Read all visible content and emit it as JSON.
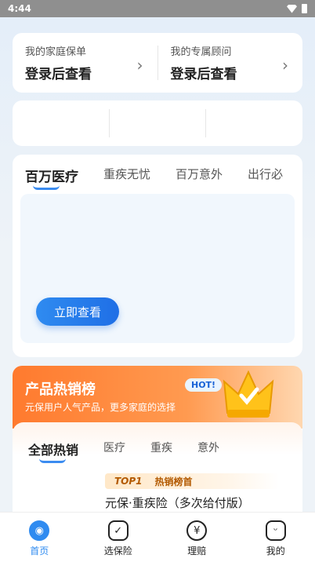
{
  "status_bar": {
    "time": "4:44"
  },
  "policy_card": {
    "left": {
      "label": "我的家庭保单",
      "value": "登录后查看"
    },
    "right": {
      "label": "我的专属顾问",
      "value": "登录后查看"
    }
  },
  "product_tabs": [
    "百万医疗",
    "重疾无忧",
    "百万意外",
    "出行必"
  ],
  "product_panel": {
    "button_label": "立即查看"
  },
  "hot_section": {
    "title": "产品热销榜",
    "subtitle": "元保用户人气产品，更多家庭的选择",
    "badge": "HOT!",
    "tabs": [
      "全部热销",
      "医疗",
      "重疾",
      "意外"
    ],
    "top_tag": "TOP1",
    "top_label": "热销榜首",
    "product_name": "元保·重疾险（多次给付版）"
  },
  "bottom_nav": [
    {
      "label": "首页",
      "icon": "home-shield-icon",
      "active": true
    },
    {
      "label": "选保险",
      "icon": "shield-check-icon",
      "active": false
    },
    {
      "label": "理赔",
      "icon": "yuan-icon",
      "active": false
    },
    {
      "label": "我的",
      "icon": "face-icon",
      "active": false
    }
  ],
  "colors": {
    "accent": "#2f8bf0",
    "hot_orange": "#ff7a2e"
  }
}
